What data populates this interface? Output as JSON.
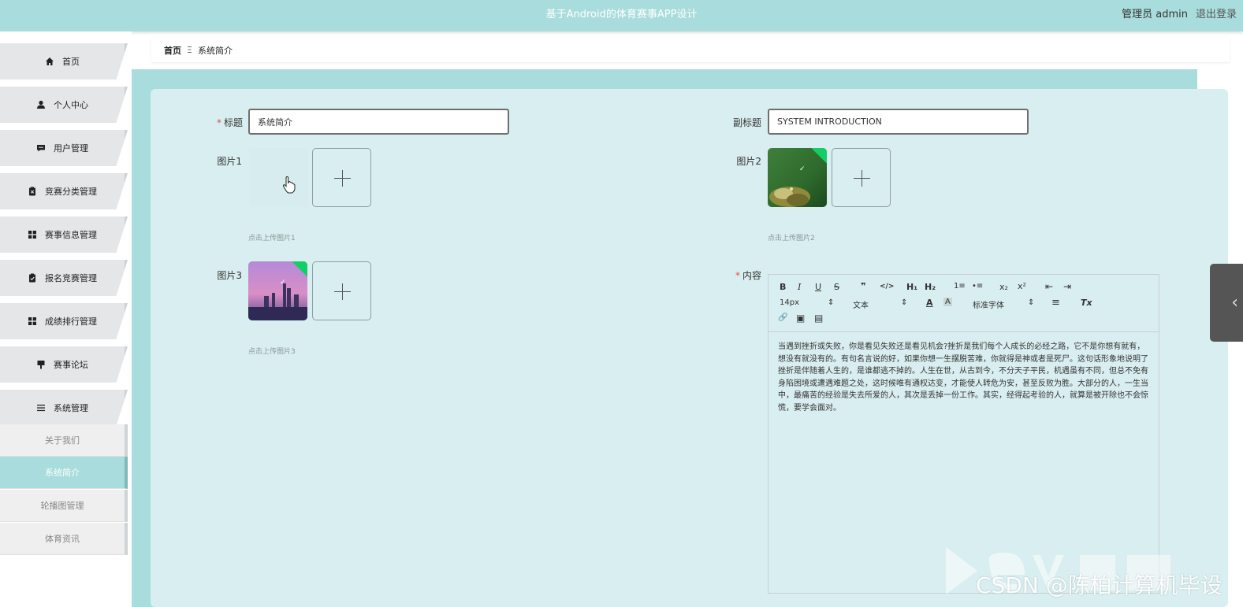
{
  "header": {
    "app_title": "基于Android的体育赛事APP设计",
    "user": "管理员 admin",
    "logout": "退出登录"
  },
  "sidebar": {
    "items": [
      {
        "label": "首页",
        "icon": "home-icon"
      },
      {
        "label": "个人中心",
        "icon": "user-icon"
      },
      {
        "label": "用户管理",
        "icon": "chat-icon"
      },
      {
        "label": "竞赛分类管理",
        "icon": "clipboard-x-icon"
      },
      {
        "label": "赛事信息管理",
        "icon": "grid-icon"
      },
      {
        "label": "报名竞赛管理",
        "icon": "clipboard-check-icon"
      },
      {
        "label": "成绩排行管理",
        "icon": "grid-icon"
      },
      {
        "label": "赛事论坛",
        "icon": "forum-icon"
      },
      {
        "label": "系统管理",
        "icon": "menu-icon"
      }
    ],
    "subitems": [
      {
        "label": "关于我们",
        "active": false
      },
      {
        "label": "系统简介",
        "active": true
      },
      {
        "label": "轮播图管理",
        "active": false
      },
      {
        "label": "体育资讯",
        "active": false
      }
    ]
  },
  "breadcrumb": {
    "home": "首页",
    "separator": "Ξ",
    "current": "系统简介"
  },
  "form": {
    "title_label": "标题",
    "title_value": "系统简介",
    "subtitle_label": "副标题",
    "subtitle_value": "SYSTEM INTRODUCTION",
    "image1_label": "图片1",
    "image1_hint": "点击上传图片1",
    "image2_label": "图片2",
    "image2_hint": "点击上传图片2",
    "image3_label": "图片3",
    "image3_hint": "点击上传图片3",
    "content_label": "内容",
    "required_mark": "*",
    "check_mark": "✓"
  },
  "editor": {
    "font_size": "14px",
    "heading_select": "文本",
    "font_family_select": "标准字体",
    "buttons": {
      "bold": "B",
      "italic": "I",
      "underline": "U",
      "strike": "S",
      "quote": "❞",
      "code": "</>",
      "h1": "H₁",
      "h2": "H₂",
      "ordered_list": "1≡",
      "bullet_list": "•≡",
      "subscript": "x₂",
      "superscript": "x²",
      "outdent": "⇤",
      "indent": "⇥",
      "color": "A",
      "background": "A",
      "align": "≡",
      "clean": "Tx",
      "link": "🔗",
      "image": "▣",
      "video": "▤",
      "select_arrow": "⇕"
    },
    "content": "当遇到挫折或失败，你是看见失败还是看见机会?挫折是我们每个人成长的必经之路，它不是你想有就有，想没有就没有的。有句名言说的好，如果你想一生摆脱苦难，你就得是神或者是死尸。这句话形象地说明了挫折是伴随着人生的，是谁都逃不掉的。人生在世，从古到今，不分天子平民，机遇虽有不同，但总不免有身陷困境或遭遇难题之处，这时候唯有通权达变，才能使人转危为安，甚至反败为胜。大部分的人，一生当中，最痛苦的经验是失去所爱的人，其次是丢掉一份工作。其实，经得起考验的人，就算是被开除也不会惊慌，要学会面对。"
  },
  "drawer": {
    "handle_icon": "‹"
  },
  "watermark": {
    "text": "CSDN @陈柏计算机毕设"
  },
  "colors": {
    "accent": "#a9dcdc",
    "content_bg": "#d9eef0",
    "required": "#e05050",
    "upload_success": "#13ce66"
  }
}
